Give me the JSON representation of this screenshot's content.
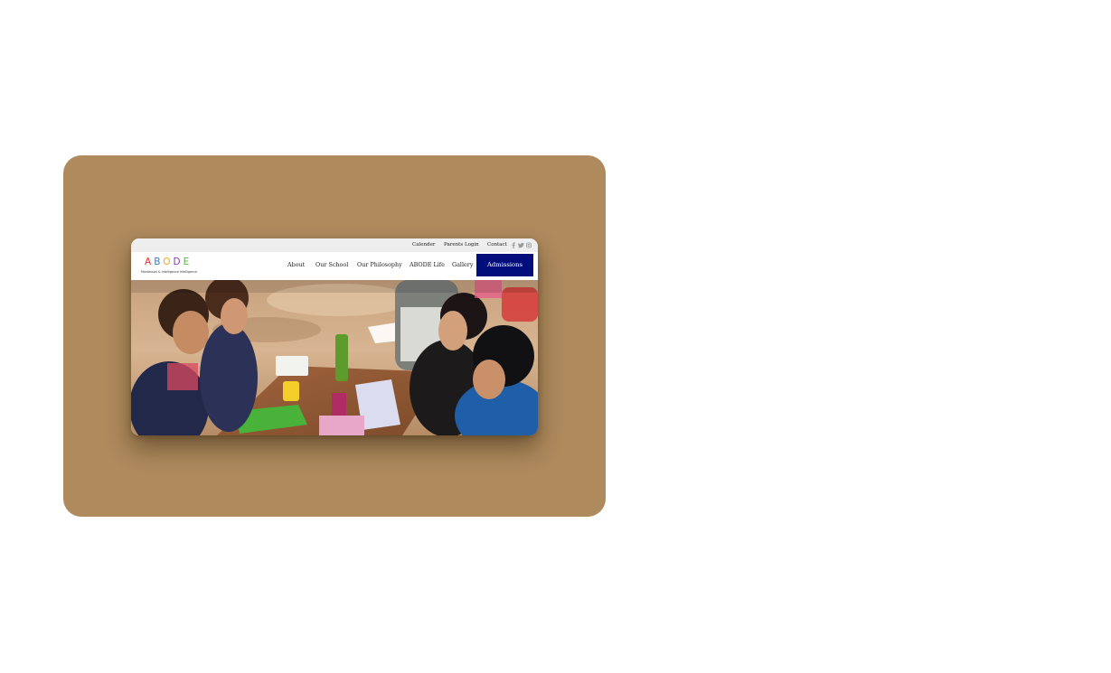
{
  "topbar": {
    "links": [
      "Calender",
      "Parents Login",
      "Contact"
    ],
    "social_icons": [
      "facebook-icon",
      "twitter-icon",
      "instagram-icon"
    ]
  },
  "logo": {
    "letters": [
      "A",
      "B",
      "O",
      "D",
      "E"
    ],
    "letter_colors": [
      "#e5322d",
      "#2f7fd0",
      "#f2a81d",
      "#8c3ab0",
      "#5bb548"
    ],
    "tagline": "Montessori & Intelligence Intelligence"
  },
  "nav": {
    "items": [
      "About",
      "Our School",
      "Our Philosophy",
      "ABODE Life",
      "Gallery"
    ],
    "cta": "Admissions"
  },
  "colors": {
    "card_background": "#ae8a5d",
    "cta_background": "#000d7a",
    "topbar_background": "#eeeeee"
  }
}
